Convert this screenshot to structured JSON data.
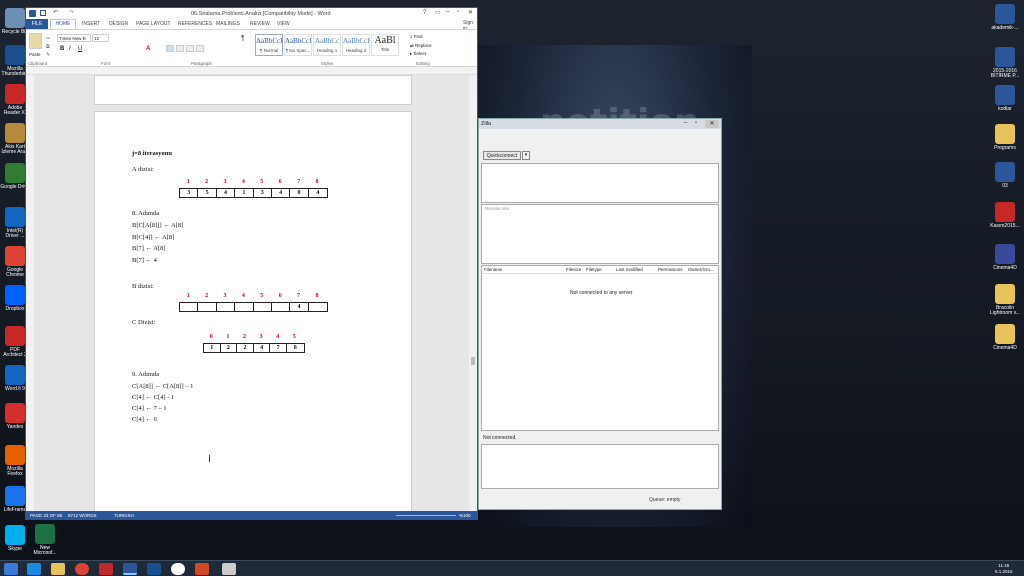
{
  "word": {
    "title": "06.Siralama.Problemi.Analizi [Compatibility Mode] - Word",
    "signin": "Sign in",
    "tabs": [
      "FILE",
      "HOME",
      "INSERT",
      "DESIGN",
      "PAGE LAYOUT",
      "REFERENCES",
      "MAILINGS",
      "REVIEW",
      "VIEW"
    ],
    "font_name": "Times New R",
    "font_size": "12",
    "paste": "Paste",
    "groups": [
      "Clipboard",
      "Font",
      "Paragraph",
      "Styles",
      "Editing"
    ],
    "styles": [
      {
        "preview": "AaBbCcI",
        "name": "¶ Normal"
      },
      {
        "preview": "AaBbCcI",
        "name": "¶ No Spac..."
      },
      {
        "preview": "AaBbCc",
        "name": "Heading 1"
      },
      {
        "preview": "AaBbCcI",
        "name": "Heading 2"
      },
      {
        "preview": "AaBl",
        "name": "Title"
      }
    ],
    "editing": {
      "find": "Find",
      "replace": "Replace",
      "select": "Select"
    },
    "status": {
      "page": "PAGE 33 OF 58",
      "words": "5712 WORDS",
      "lang": "TURKISH",
      "zoom": "%100"
    }
  },
  "doc": {
    "heading": "j=8 iterasyonu",
    "a_label": "A dizisi:",
    "a_indices": [
      "1",
      "2",
      "3",
      "4",
      "5",
      "6",
      "7",
      "8"
    ],
    "a_values": [
      "3",
      "5",
      "4",
      "1",
      "3",
      "4",
      "0",
      "4"
    ],
    "step8_title": "8. Adımda",
    "step8_lines": [
      "B[C[A[8]]] ← A[8]",
      "B[C[4]] ← A[8]",
      "B[7] ← A[8]",
      "B[7] ← 4"
    ],
    "b_label": "B dizisi:",
    "b_indices": [
      "1",
      "2",
      "3",
      "4",
      "5",
      "6",
      "7",
      "8"
    ],
    "b_values": [
      "",
      "",
      "",
      "",
      "",
      "",
      "4",
      ""
    ],
    "c_label": "C Dizisi:",
    "c_indices": [
      "0",
      "1",
      "2",
      "3",
      "4",
      "5"
    ],
    "c_values": [
      "1",
      "2",
      "2",
      "4",
      "7",
      "8"
    ],
    "step9_title": "9. Adımda",
    "step9_lines": [
      "C[A[8]] ← C[A[8]] – 1",
      "C[4] ← C[4] - 1",
      "C[4] ← 7 – 1",
      "C[4] ← 6"
    ]
  },
  "filezilla": {
    "title": "Zilla",
    "quickconnect": "Quickconnect",
    "remote_site": "Remote site:",
    "columns": [
      "Filename",
      "Filesize",
      "Filetype",
      "Last modified",
      "Permissions",
      "Owner/Gro..."
    ],
    "not_connected_server": "Not connected to any server",
    "not_connected": "Not connected.",
    "queue": "Queue: empty"
  },
  "desktop_left": [
    "Recycle Bin",
    "Mozilla Thunderbird",
    "Adobe Reader XI",
    "Akis Kart İzleme Araci",
    "Google Drive",
    "Intel(R) Driver ...",
    "Google Chrome",
    "Dropbox",
    "PDF Architect 2",
    "Word.lt 9",
    "Yandex",
    "Mozilla Firefox",
    "LifeFrame",
    "Skype",
    "New Microsof..."
  ],
  "desktop_right": [
    "akademik-...",
    "2015-2016 BİTİRME P...",
    "kodlar",
    "Programs",
    "03",
    "Kasım2015...",
    "Cinema4D",
    "Bracolin Lightroom v...",
    "Cinema4D"
  ],
  "clock": {
    "time": "11:45",
    "date": "5.1.2016"
  }
}
